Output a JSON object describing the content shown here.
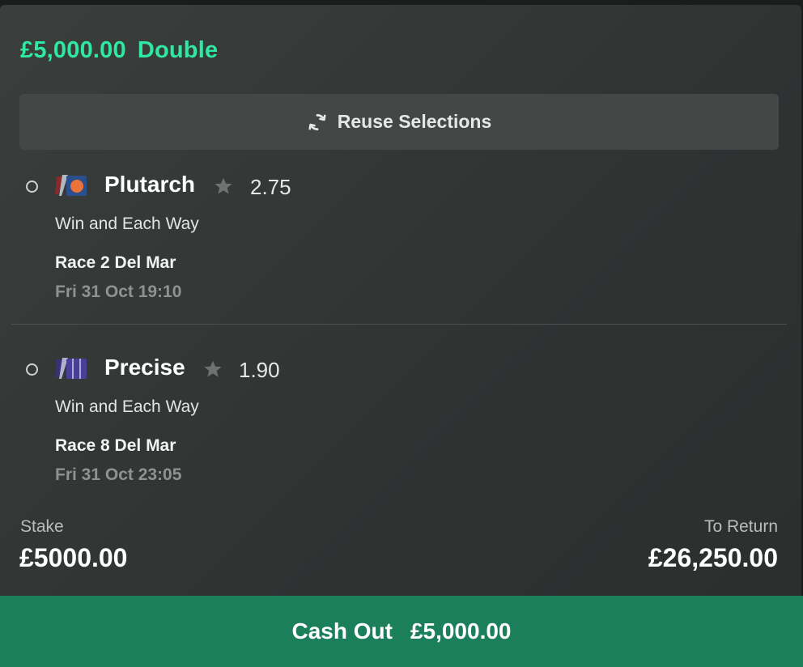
{
  "bet": {
    "amount": "£5,000.00",
    "type": "Double"
  },
  "reuse_button": {
    "label": "Reuse Selections",
    "icon": "refresh-icon"
  },
  "selections": [
    {
      "runner": "Plutarch",
      "odds": "2.75",
      "market": "Win and Each Way",
      "race": "Race 2 Del Mar",
      "time": "Fri 31 Oct 19:10",
      "silk_colors": [
        "#8b2a2a",
        "#2b4e8c",
        "#e9733a"
      ]
    },
    {
      "runner": "Precise",
      "odds": "1.90",
      "market": "Win and Each Way",
      "race": "Race 8 Del Mar",
      "time": "Fri 31 Oct 23:05",
      "silk_colors": [
        "#3b2f7a",
        "#4a3f98",
        "#c9c6e8"
      ]
    }
  ],
  "stake": {
    "label": "Stake",
    "value": "£5000.00"
  },
  "to_return": {
    "label": "To Return",
    "value": "£26,250.00"
  },
  "cash_out": {
    "label": "Cash Out",
    "amount": "£5,000.00"
  },
  "colors": {
    "accent": "#2fe8a3",
    "cash_out_bg": "#1a7f5a",
    "card_bg": "#333736"
  }
}
